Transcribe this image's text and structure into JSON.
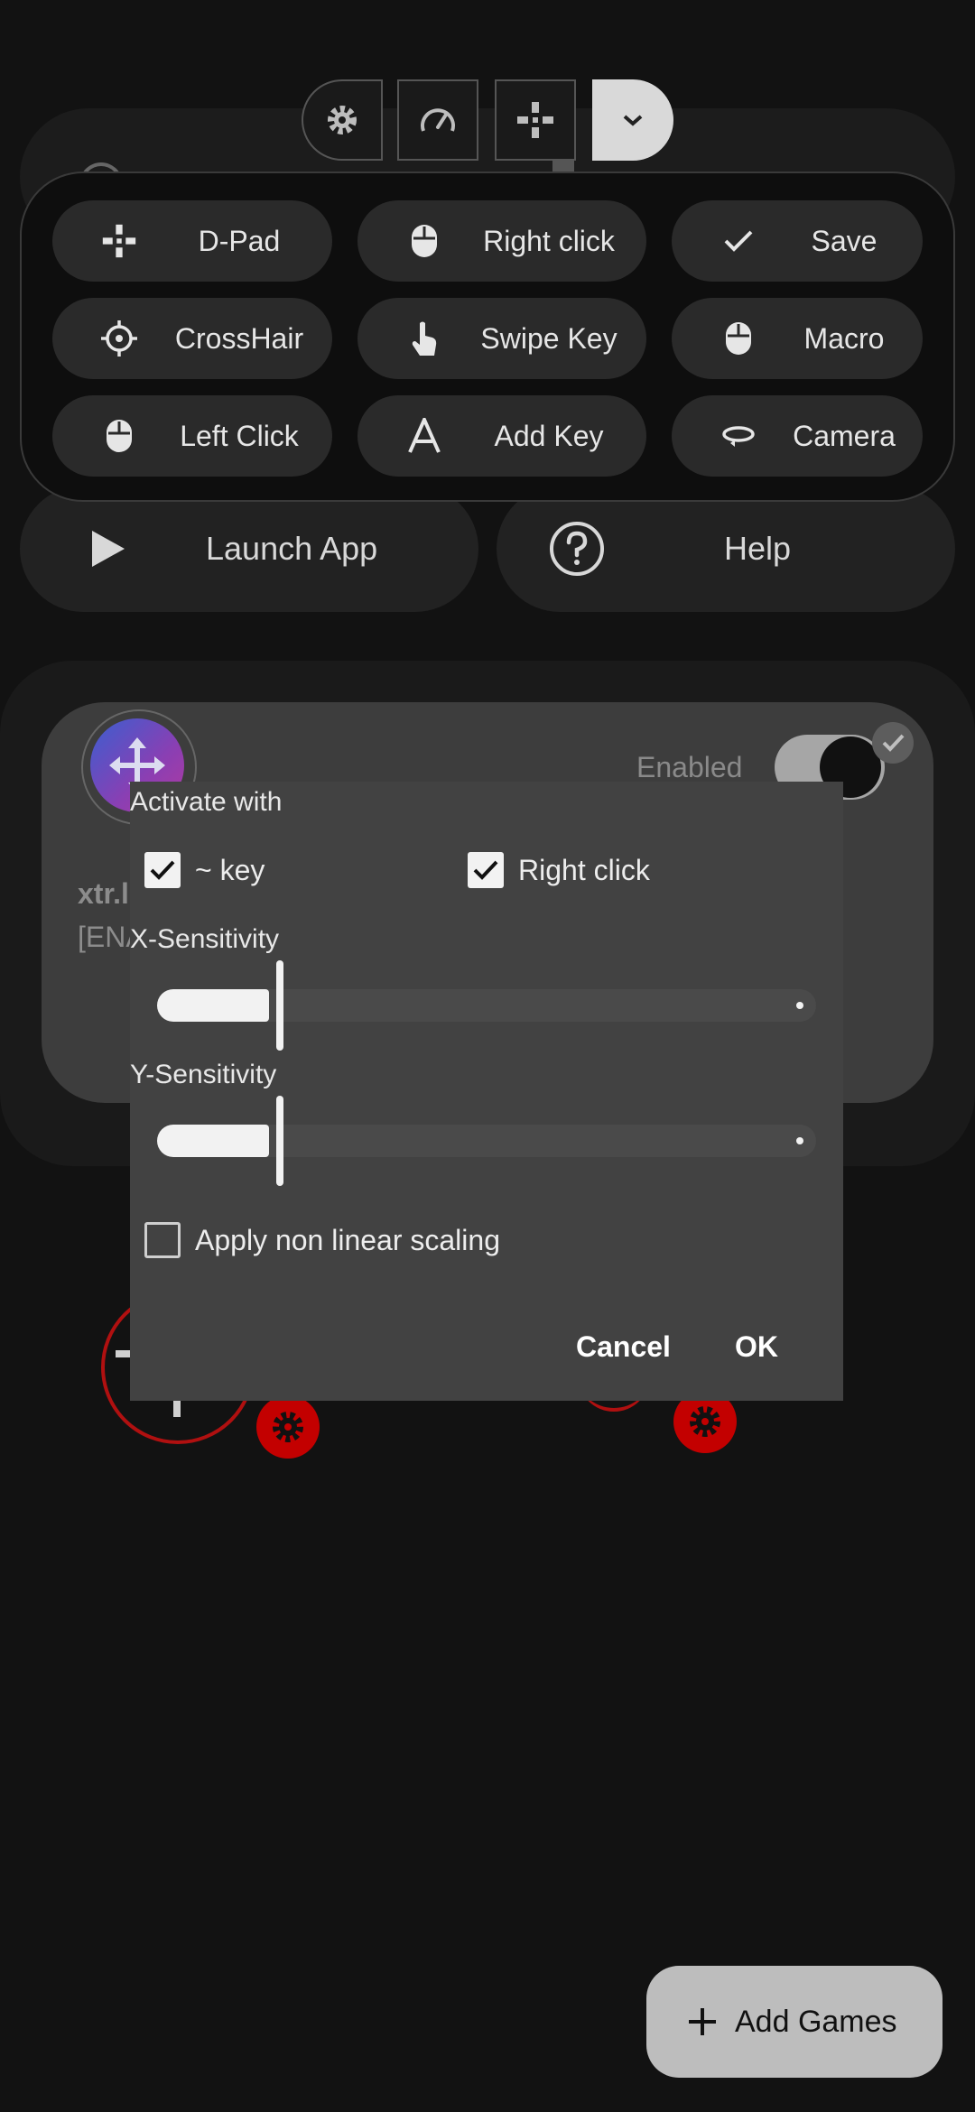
{
  "toolbar": {
    "icons": [
      "gear-icon",
      "speedometer-icon",
      "dpad-icon",
      "chevron-down-icon"
    ]
  },
  "key_panel": {
    "buttons": [
      {
        "label": "D-Pad",
        "icon": "dpad-icon"
      },
      {
        "label": "Right click",
        "icon": "mouse-icon"
      },
      {
        "label": "Save",
        "icon": "check-icon"
      },
      {
        "label": "CrossHair",
        "icon": "crosshair-icon"
      },
      {
        "label": "Swipe Key",
        "icon": "swipe-hand-icon"
      },
      {
        "label": "Macro",
        "icon": "mouse-icon"
      },
      {
        "label": "Left Click",
        "icon": "mouse-icon"
      },
      {
        "label": "Add Key",
        "icon": "letter-a-icon"
      },
      {
        "label": "Camera",
        "icon": "rotate-icon"
      }
    ]
  },
  "background": {
    "launch_label": "Launch App",
    "help_label": "Help",
    "enabled_label": "Enabled",
    "package_prefix": "xtr.l",
    "status_prefix": "[ENA"
  },
  "dialog": {
    "title": "Activate with",
    "option_key": {
      "label": "~ key",
      "checked": true
    },
    "option_right_click": {
      "label": "Right click",
      "checked": true
    },
    "x_label": "X-Sensitivity",
    "x_value": 0.17,
    "y_label": "Y-Sensitivity",
    "y_value": 0.17,
    "nonlinear": {
      "label": "Apply non linear scaling",
      "checked": false
    },
    "cancel": "Cancel",
    "ok": "OK"
  },
  "fab": {
    "label": "Add Games"
  },
  "colors": {
    "accent_red": "#c30000",
    "dialog_bg": "#424242",
    "background": "#121212"
  }
}
